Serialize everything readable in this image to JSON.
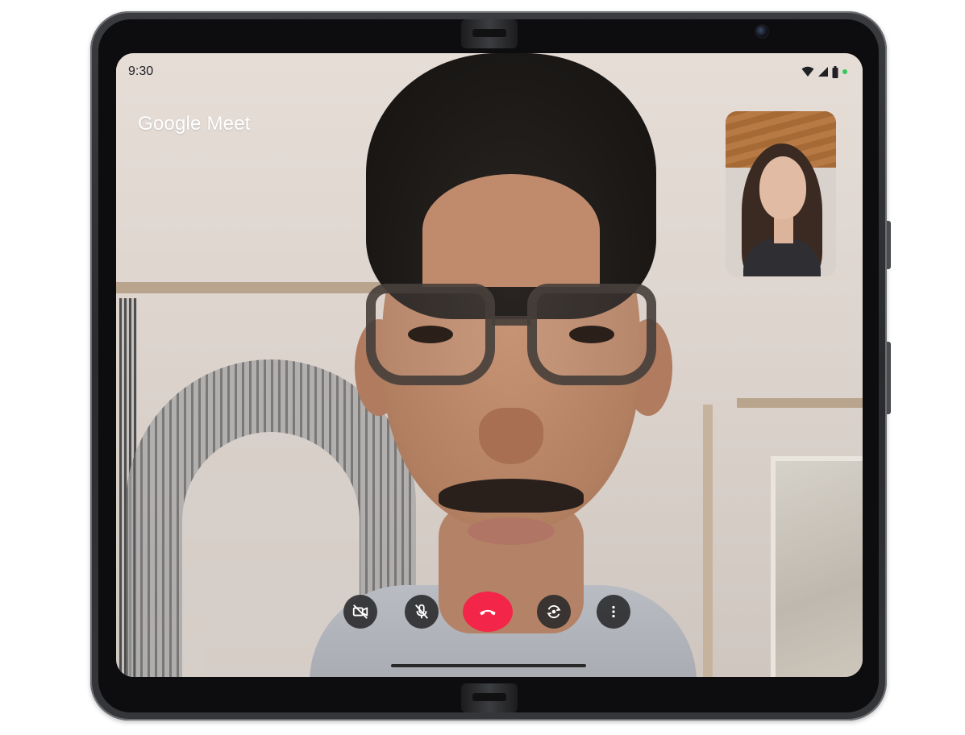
{
  "status_bar": {
    "time": "9:30",
    "icons": [
      "wifi-icon",
      "cellular-signal-icon",
      "battery-icon",
      "privacy-indicator-dot"
    ]
  },
  "app": {
    "title": "Google Meet"
  },
  "controls": {
    "items": [
      {
        "name": "camera-off-button",
        "icon": "video-off-icon"
      },
      {
        "name": "mute-button",
        "icon": "mic-off-icon"
      },
      {
        "name": "end-call-button",
        "icon": "hang-up-icon"
      },
      {
        "name": "flip-camera-button",
        "icon": "camera-switch-icon"
      },
      {
        "name": "more-options-button",
        "icon": "more-vertical-icon"
      }
    ]
  },
  "colors": {
    "end_call": "#f3264a",
    "control_bg": "#2d2d2f",
    "privacy_dot": "#34c759",
    "title_text": "#ffffff",
    "status_text": "#202124"
  }
}
